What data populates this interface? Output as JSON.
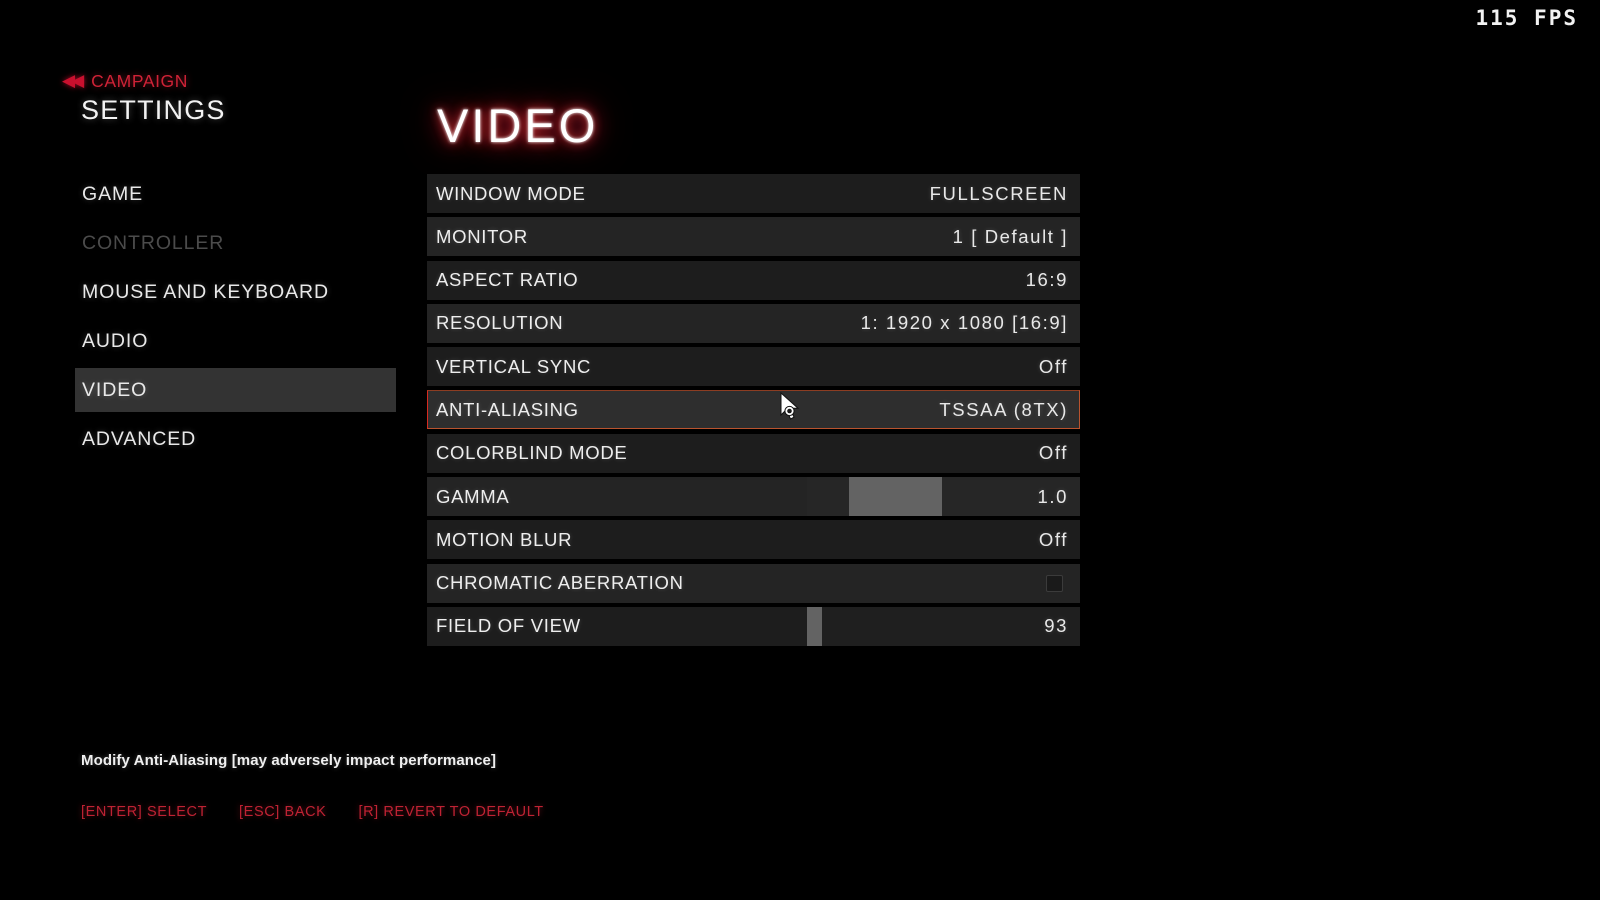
{
  "hud": {
    "fps_text": "115 FPS"
  },
  "header": {
    "back_glyph": "◀◀",
    "breadcrumb": "CAMPAIGN",
    "title": "SETTINGS"
  },
  "sidebar": {
    "items": [
      {
        "label": "GAME",
        "state": "normal"
      },
      {
        "label": "CONTROLLER",
        "state": "disabled"
      },
      {
        "label": "MOUSE AND KEYBOARD",
        "state": "normal"
      },
      {
        "label": "AUDIO",
        "state": "normal"
      },
      {
        "label": "VIDEO",
        "state": "active"
      },
      {
        "label": "ADVANCED",
        "state": "normal"
      }
    ]
  },
  "main": {
    "page_title": "VIDEO",
    "rows": [
      {
        "label": "WINDOW MODE",
        "value": "FULLSCREEN",
        "type": "option"
      },
      {
        "label": "MONITOR",
        "value": "1 [ Default ]",
        "type": "option"
      },
      {
        "label": "ASPECT RATIO",
        "value": "16:9",
        "type": "option"
      },
      {
        "label": "RESOLUTION",
        "value": "1: 1920 x 1080 [16:9]",
        "type": "option"
      },
      {
        "label": "VERTICAL SYNC",
        "value": "Off",
        "type": "option"
      },
      {
        "label": "ANTI-ALIASING",
        "value": "TSSAA (8TX)",
        "type": "option",
        "selected": true
      },
      {
        "label": "COLORBLIND MODE",
        "value": "Off",
        "type": "option"
      },
      {
        "label": "GAMMA",
        "value": "1.0",
        "type": "slider",
        "fill_start_pct": 15.5,
        "fill_end_pct": 49.5
      },
      {
        "label": "MOTION BLUR",
        "value": "Off",
        "type": "option"
      },
      {
        "label": "CHROMATIC ABERRATION",
        "value": "",
        "type": "checkbox",
        "checked": false
      },
      {
        "label": "FIELD OF VIEW",
        "value": "93",
        "type": "slider",
        "fill_start_pct": 0,
        "fill_end_pct": 5.5
      }
    ]
  },
  "footer": {
    "description": "Modify Anti-Aliasing [may adversely impact performance]",
    "hints": [
      "[ENTER] SELECT",
      "[ESC] BACK",
      "[R] REVERT TO DEFAULT"
    ]
  },
  "colors": {
    "accent_red": "#c8102e",
    "selected_border": "#b9532e",
    "slider_fill": "#636363",
    "row_bg_a": "#1d1d1d",
    "row_bg_b": "#242424",
    "active_nav_bg": "#333333"
  }
}
